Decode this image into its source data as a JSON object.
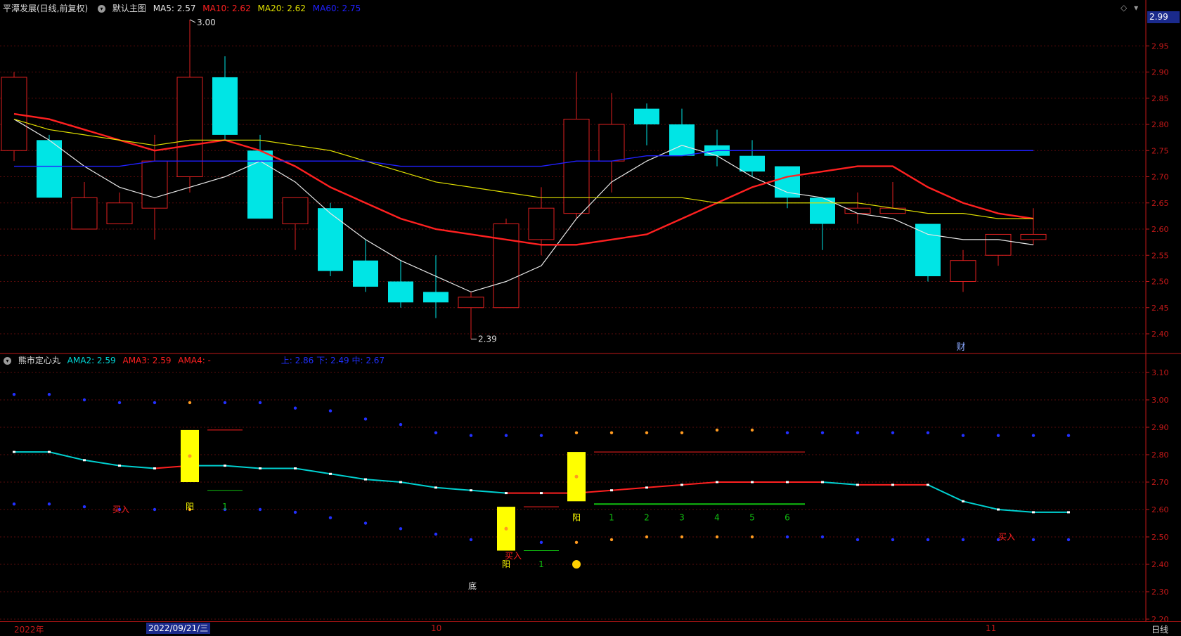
{
  "header_main": {
    "title": "平潭发展(日线,前复权)",
    "indicator": "默认主图",
    "ma5": "MA5: 2.57",
    "ma10": "MA10: 2.62",
    "ma20": "MA20: 2.62",
    "ma60": "MA60: 2.75"
  },
  "header_indicator": {
    "name": "熊市定心丸",
    "ama2": "AMA2: 2.59",
    "ama3": "AMA3: 2.59",
    "ama4": "AMA4: -",
    "bands": "上: 2.86  下: 2.49  中: 2.67"
  },
  "last_price": "2.99",
  "period": "日线",
  "dates": {
    "start": "2022年",
    "cursor": "2022/09/21/三",
    "oct": "10",
    "nov": "11"
  },
  "colors": {
    "up": "#e02020",
    "down": "#00e5e5",
    "ma5": "#e8e8e8",
    "ma10": "#ff2020",
    "ma20": "#e0e000",
    "ma60": "#2020ff",
    "axis": "#c01818",
    "grid": "#5a0b0b"
  },
  "chart_data": [
    {
      "type": "candlestick",
      "title": "平潭发展(日线,前复权)",
      "ylim": [
        2.35,
        3.05
      ],
      "yticks": [
        "2.95",
        "2.90",
        "2.85",
        "2.80",
        "2.75",
        "2.70",
        "2.65",
        "2.60",
        "2.55",
        "2.50",
        "2.45",
        "2.40"
      ],
      "annotations": [
        {
          "label": "3.00"
        },
        {
          "label": "2.39"
        },
        {
          "label": "财"
        }
      ],
      "candles": [
        {
          "o": 2.75,
          "h": 2.9,
          "l": 2.73,
          "c": 2.89
        },
        {
          "o": 2.77,
          "h": 2.78,
          "l": 2.66,
          "c": 2.66
        },
        {
          "o": 2.6,
          "h": 2.69,
          "l": 2.6,
          "c": 2.66
        },
        {
          "o": 2.61,
          "h": 2.67,
          "l": 2.61,
          "c": 2.65
        },
        {
          "o": 2.64,
          "h": 2.78,
          "l": 2.58,
          "c": 2.73
        },
        {
          "o": 2.7,
          "h": 3.0,
          "l": 2.67,
          "c": 2.89
        },
        {
          "o": 2.89,
          "h": 2.93,
          "l": 2.77,
          "c": 2.78
        },
        {
          "o": 2.75,
          "h": 2.78,
          "l": 2.62,
          "c": 2.62
        },
        {
          "o": 2.61,
          "h": 2.66,
          "l": 2.56,
          "c": 2.66
        },
        {
          "o": 2.64,
          "h": 2.65,
          "l": 2.51,
          "c": 2.52
        },
        {
          "o": 2.54,
          "h": 2.58,
          "l": 2.48,
          "c": 2.49
        },
        {
          "o": 2.5,
          "h": 2.54,
          "l": 2.45,
          "c": 2.46
        },
        {
          "o": 2.48,
          "h": 2.55,
          "l": 2.43,
          "c": 2.46
        },
        {
          "o": 2.45,
          "h": 2.48,
          "l": 2.39,
          "c": 2.47
        },
        {
          "o": 2.45,
          "h": 2.62,
          "l": 2.45,
          "c": 2.61
        },
        {
          "o": 2.58,
          "h": 2.68,
          "l": 2.55,
          "c": 2.64
        },
        {
          "o": 2.63,
          "h": 2.9,
          "l": 2.62,
          "c": 2.81
        },
        {
          "o": 2.73,
          "h": 2.86,
          "l": 2.67,
          "c": 2.8
        },
        {
          "o": 2.83,
          "h": 2.84,
          "l": 2.76,
          "c": 2.8
        },
        {
          "o": 2.8,
          "h": 2.83,
          "l": 2.74,
          "c": 2.74
        },
        {
          "o": 2.76,
          "h": 2.79,
          "l": 2.72,
          "c": 2.74
        },
        {
          "o": 2.74,
          "h": 2.77,
          "l": 2.7,
          "c": 2.71
        },
        {
          "o": 2.72,
          "h": 2.72,
          "l": 2.64,
          "c": 2.66
        },
        {
          "o": 2.66,
          "h": 2.66,
          "l": 2.56,
          "c": 2.61
        },
        {
          "o": 2.63,
          "h": 2.67,
          "l": 2.61,
          "c": 2.64
        },
        {
          "o": 2.63,
          "h": 2.69,
          "l": 2.63,
          "c": 2.64
        },
        {
          "o": 2.61,
          "h": 2.61,
          "l": 2.5,
          "c": 2.51
        },
        {
          "o": 2.5,
          "h": 2.56,
          "l": 2.48,
          "c": 2.54
        },
        {
          "o": 2.55,
          "h": 2.59,
          "l": 2.53,
          "c": 2.59
        },
        {
          "o": 2.58,
          "h": 2.64,
          "l": 2.57,
          "c": 2.59
        }
      ],
      "series": [
        {
          "name": "MA5",
          "values": [
            2.81,
            2.77,
            2.72,
            2.68,
            2.66,
            2.68,
            2.7,
            2.73,
            2.69,
            2.63,
            2.58,
            2.54,
            2.51,
            2.48,
            2.5,
            2.53,
            2.62,
            2.69,
            2.73,
            2.76,
            2.74,
            2.7,
            2.67,
            2.66,
            2.63,
            2.62,
            2.59,
            2.58,
            2.58,
            2.57
          ]
        },
        {
          "name": "MA10",
          "values": [
            2.82,
            2.81,
            2.79,
            2.77,
            2.75,
            2.76,
            2.77,
            2.75,
            2.72,
            2.68,
            2.65,
            2.62,
            2.6,
            2.59,
            2.58,
            2.57,
            2.57,
            2.58,
            2.59,
            2.62,
            2.65,
            2.68,
            2.7,
            2.71,
            2.72,
            2.72,
            2.68,
            2.65,
            2.63,
            2.62
          ]
        },
        {
          "name": "MA20",
          "values": [
            2.81,
            2.79,
            2.78,
            2.77,
            2.76,
            2.77,
            2.77,
            2.77,
            2.76,
            2.75,
            2.73,
            2.71,
            2.69,
            2.68,
            2.67,
            2.66,
            2.66,
            2.66,
            2.66,
            2.66,
            2.65,
            2.65,
            2.65,
            2.65,
            2.65,
            2.64,
            2.63,
            2.63,
            2.62,
            2.62
          ]
        },
        {
          "name": "MA60",
          "values": [
            2.72,
            2.72,
            2.72,
            2.72,
            2.73,
            2.73,
            2.73,
            2.73,
            2.73,
            2.73,
            2.73,
            2.72,
            2.72,
            2.72,
            2.72,
            2.72,
            2.73,
            2.73,
            2.74,
            2.74,
            2.75,
            2.75,
            2.75,
            2.75,
            2.75,
            2.75,
            2.75,
            2.75,
            2.75,
            2.75
          ]
        }
      ]
    },
    {
      "type": "line",
      "title": "熊市定心丸",
      "ylim": [
        2.17,
        3.13
      ],
      "yticks": [
        "3.10",
        "3.00",
        "2.90",
        "2.80",
        "2.70",
        "2.60",
        "2.50",
        "2.40",
        "2.30",
        "2.20"
      ],
      "series": [
        {
          "name": "AMA2",
          "values": [
            2.81,
            2.81,
            2.78,
            2.76,
            2.75,
            2.76,
            2.76,
            2.75,
            2.75,
            2.73,
            2.71,
            2.7,
            2.68,
            2.67,
            2.66,
            2.66,
            2.66,
            2.67,
            2.68,
            2.69,
            2.7,
            2.7,
            2.7,
            2.7,
            2.69,
            2.69,
            2.69,
            2.63,
            2.6,
            2.59,
            2.59
          ]
        },
        {
          "name": "AMA3",
          "values": [
            2.81,
            2.81,
            2.78,
            2.76,
            2.75,
            2.76,
            2.76,
            2.75,
            2.75,
            2.73,
            2.71,
            2.7,
            2.68,
            2.67,
            2.66,
            2.66,
            2.66,
            2.67,
            2.68,
            2.69,
            2.7,
            2.7,
            2.7,
            2.7,
            2.69,
            2.69,
            2.69,
            2.63,
            2.6,
            2.59,
            2.59
          ]
        },
        {
          "name": "上",
          "values": [
            3.02,
            3.02,
            3.0,
            2.99,
            2.99,
            2.99,
            2.99,
            2.99,
            2.97,
            2.96,
            2.93,
            2.91,
            2.88,
            2.87,
            2.87,
            2.87,
            2.88,
            2.88,
            2.88,
            2.88,
            2.89,
            2.89,
            2.88,
            2.88,
            2.88,
            2.88,
            2.88,
            2.87,
            2.87,
            2.87,
            2.87
          ]
        },
        {
          "name": "下",
          "values": [
            2.62,
            2.62,
            2.61,
            2.6,
            2.6,
            2.6,
            2.6,
            2.6,
            2.59,
            2.57,
            2.55,
            2.53,
            2.51,
            2.49,
            2.49,
            2.48,
            2.48,
            2.49,
            2.5,
            2.5,
            2.5,
            2.5,
            2.5,
            2.5,
            2.49,
            2.49,
            2.49,
            2.49,
            2.49,
            2.49,
            2.49
          ]
        }
      ],
      "annotations": [
        {
          "label": "买入"
        },
        {
          "label": "阳"
        },
        {
          "label": "1"
        },
        {
          "label": "阳"
        },
        {
          "label": "1"
        },
        {
          "label": "阳"
        },
        {
          "label": "1"
        },
        {
          "label": "2"
        },
        {
          "label": "3"
        },
        {
          "label": "4"
        },
        {
          "label": "5"
        },
        {
          "label": "6"
        },
        {
          "label": "买入"
        },
        {
          "label": "买入"
        },
        {
          "label": "底"
        }
      ]
    }
  ]
}
